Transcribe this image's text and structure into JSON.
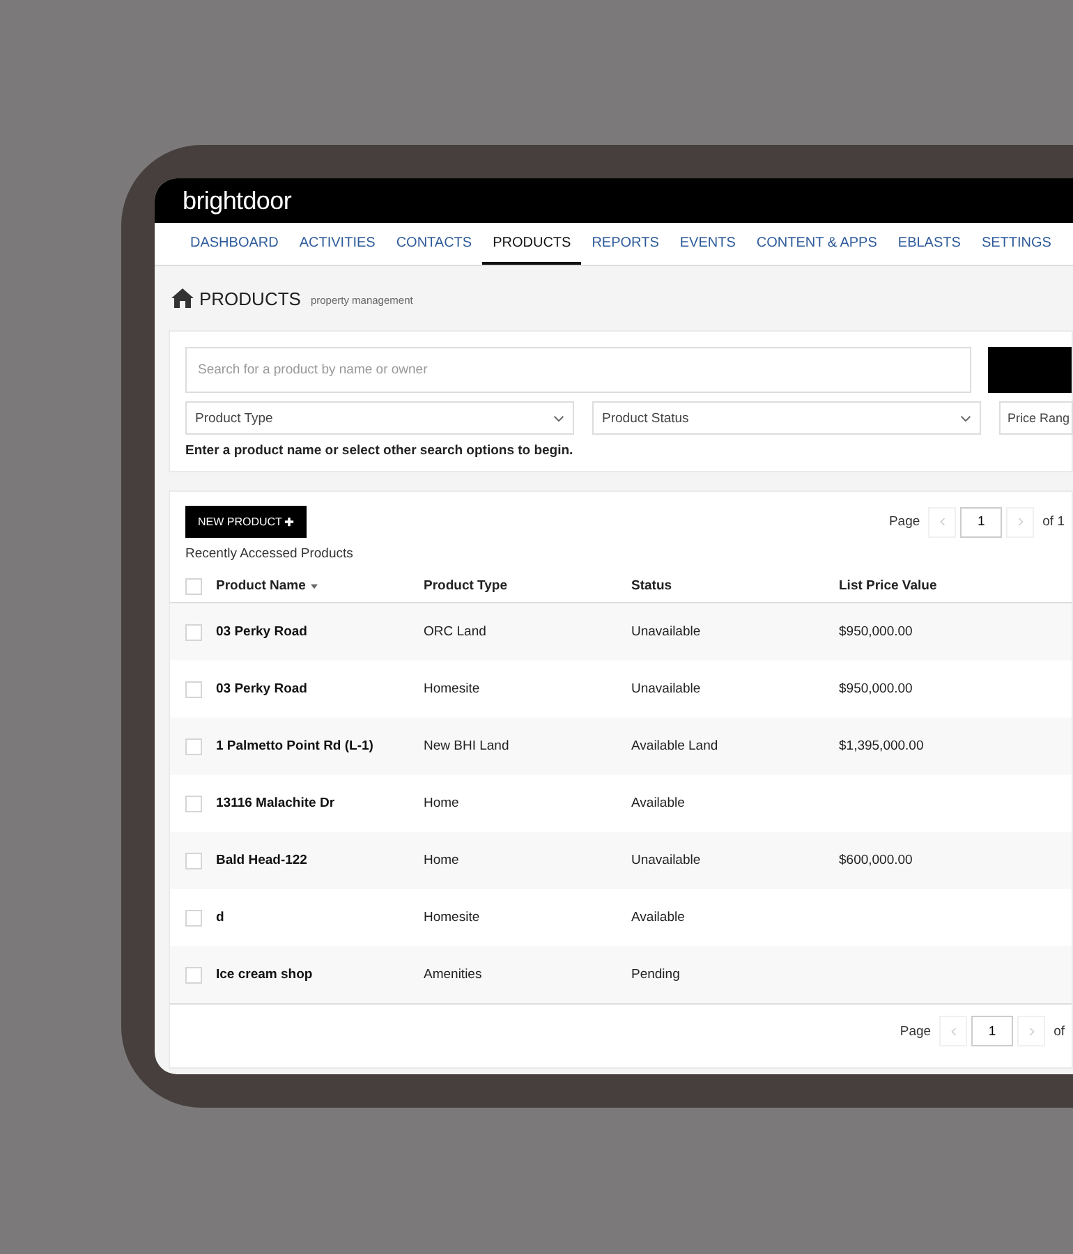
{
  "brand": "brightdoor",
  "nav": [
    {
      "label": "DASHBOARD",
      "selected": false
    },
    {
      "label": "ACTIVITIES",
      "selected": false
    },
    {
      "label": "CONTACTS",
      "selected": false
    },
    {
      "label": "PRODUCTS",
      "selected": true
    },
    {
      "label": "REPORTS",
      "selected": false
    },
    {
      "label": "EVENTS",
      "selected": false
    },
    {
      "label": "CONTENT & APPS",
      "selected": false
    },
    {
      "label": "EBLASTS",
      "selected": false
    },
    {
      "label": "SETTINGS",
      "selected": false
    }
  ],
  "page": {
    "title": "PRODUCTS",
    "subtitle": "property management"
  },
  "search": {
    "placeholder": "Search for a product by name or owner",
    "filters": [
      {
        "placeholder": "Product Type"
      },
      {
        "placeholder": "Product Status"
      },
      {
        "placeholder": "Price Rang"
      }
    ],
    "hint": "Enter a product name or select other search options to begin."
  },
  "products": {
    "new_button": "NEW PRODUCT",
    "section_title": "Recently Accessed Products",
    "pager_top": {
      "label": "Page",
      "value": "1",
      "of": "of 1"
    },
    "columns": [
      "Product Name",
      "Product Type",
      "Status",
      "List Price Value"
    ],
    "select_all_checked": false,
    "rows": [
      {
        "name": "03 Perky Road",
        "type": "ORC Land",
        "status": "Unavailable",
        "price": "$950,000.00",
        "checked": false
      },
      {
        "name": "03 Perky Road",
        "type": "Homesite",
        "status": "Unavailable",
        "price": "$950,000.00",
        "checked": false
      },
      {
        "name": "1 Palmetto Point Rd (L-1)",
        "type": "New BHI Land",
        "status": "Available Land",
        "price": "$1,395,000.00",
        "checked": false
      },
      {
        "name": "13116 Malachite Dr",
        "type": "Home",
        "status": "Available",
        "checked": false
      },
      {
        "name": "Bald Head-122",
        "type": "Home",
        "status": "Unavailable",
        "price": "$600,000.00",
        "checked": false
      },
      {
        "name": "d",
        "type": "Homesite",
        "status": "Available",
        "checked": false
      },
      {
        "name": "Ice cream shop",
        "type": "Amenities",
        "status": "Pending",
        "checked": false
      }
    ],
    "pager_bottom": {
      "label": "Page",
      "value": "1",
      "of": "of"
    }
  }
}
